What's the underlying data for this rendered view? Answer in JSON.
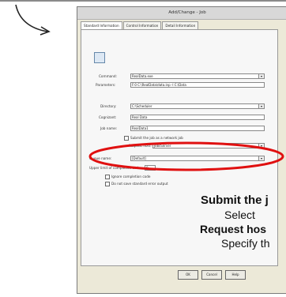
{
  "dialog": {
    "title": "Add/Change - Job",
    "tabs": [
      "Standard Information",
      "Control Information",
      "Detail Information"
    ]
  },
  "form": {
    "command_label": "Command:",
    "command_value": "RealData.exe",
    "parameters_label": "Parameters:",
    "parameters_value": "F:0 C:\\RealData\\data.inp -l C:\\Data",
    "directory_label": "Directory:",
    "directory_value": "C:\\Scheduler",
    "owner_label": "Cognizant:",
    "owner_value": "Real Data",
    "job_name_label": "Job name:",
    "job_name_value": "RealData1",
    "submit_remote_label": "Submit the job as a network job",
    "request_host_label": "Request host:",
    "request_host_value": "JobsServer",
    "queue_label": "Queue name:",
    "queue_value": "[Default]",
    "upper_limit_label": "Upper limit of completion code:",
    "upper_limit_value": "0",
    "ignore_code_label": "Ignore completion code",
    "dont_save_output_label": "Do not save standard error output"
  },
  "overlay": {
    "line1": "Submit the j",
    "line2": "Select",
    "line3": "Request hos",
    "line4": "Specify th"
  },
  "buttons": {
    "ok": "OK",
    "cancel": "Cancel",
    "help": "Help"
  },
  "colors": {
    "highlight": "#e01010",
    "dialog_bg": "#ece9d8"
  }
}
